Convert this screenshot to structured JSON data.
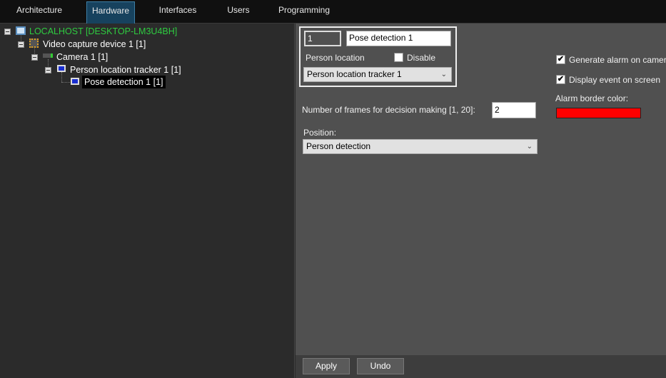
{
  "tabs": [
    {
      "label": "Architecture"
    },
    {
      "label": "Hardware",
      "active": true
    },
    {
      "label": "Interfaces"
    },
    {
      "label": "Users"
    },
    {
      "label": "Programming"
    }
  ],
  "tree": {
    "host": "LOCALHOST [DESKTOP-LM3U4BH]",
    "device": "Video capture device 1 [1]",
    "camera": "Camera 1 [1]",
    "tracker": "Person location tracker 1 [1]",
    "pose": "Pose detection 1 [1]"
  },
  "form": {
    "id_value": "1",
    "name_value": "Pose detection 1",
    "person_location_label": "Person location",
    "disable_label": "Disable",
    "disable_checked": false,
    "tracker_select": "Person location tracker 1",
    "frames_label": "Number of frames for decision making [1, 20]:",
    "frames_value": "2",
    "position_label": "Position:",
    "position_select": "Person detection",
    "generate_alarm_label": "Generate alarm on camera",
    "generate_alarm_checked": true,
    "display_event_label": "Display event on screen",
    "display_event_checked": true,
    "alarm_color_label": "Alarm border color:",
    "alarm_color": "#ff0000"
  },
  "buttons": {
    "apply": "Apply",
    "undo": "Undo"
  },
  "colors": {
    "host_text": "#2ecc40",
    "active_tab": "#17425e"
  }
}
